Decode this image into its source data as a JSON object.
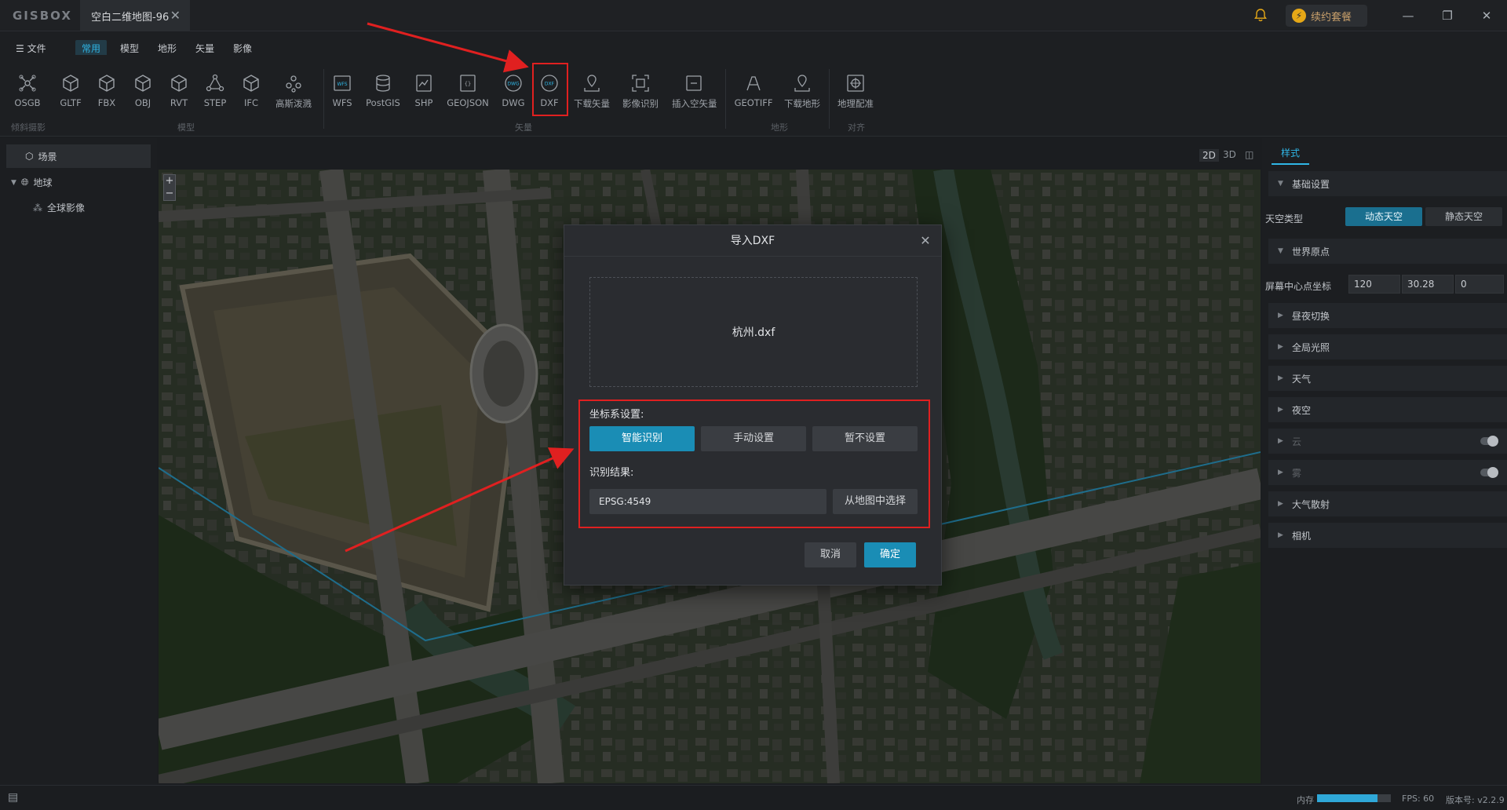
{
  "titlebar": {
    "logo": "GISBOX",
    "doc_tab": "空白二维地图-96",
    "close_glyph": "✕",
    "renew_label": "续约套餐",
    "min_glyph": "—",
    "restore_glyph": "❐",
    "close_window_glyph": "✕"
  },
  "menubar": {
    "file": "文件",
    "tabs": [
      "常用",
      "模型",
      "地形",
      "矢量",
      "影像"
    ],
    "active_tab": "常用"
  },
  "ribbon": {
    "groups": {
      "oblique": "倾斜摄影",
      "model": "模型",
      "vector": "矢量",
      "terrain": "地形",
      "align": "对齐"
    },
    "tools": [
      {
        "label": "OSGB",
        "icon": "osgb-icon"
      },
      {
        "label": "GLTF",
        "icon": "cube-icon"
      },
      {
        "label": "FBX",
        "icon": "cube-icon"
      },
      {
        "label": "OBJ",
        "icon": "cube-icon"
      },
      {
        "label": "RVT",
        "icon": "cube-icon"
      },
      {
        "label": "STEP",
        "icon": "cube-icon"
      },
      {
        "label": "IFC",
        "icon": "cube-icon"
      },
      {
        "label": "高斯泼溅",
        "icon": "splat-icon"
      },
      {
        "label": "WFS",
        "icon": "wfs-icon"
      },
      {
        "label": "PostGIS",
        "icon": "database-icon"
      },
      {
        "label": "SHP",
        "icon": "shp-icon"
      },
      {
        "label": "GEOJSON",
        "icon": "geojson-icon"
      },
      {
        "label": "DWG",
        "icon": "dwg-icon"
      },
      {
        "label": "DXF",
        "icon": "dxf-icon"
      },
      {
        "label": "下载矢量",
        "icon": "download-vector-icon"
      },
      {
        "label": "影像识别",
        "icon": "image-recognition-icon"
      },
      {
        "label": "插入空矢量",
        "icon": "insert-vector-icon"
      },
      {
        "label": "GEOTIFF",
        "icon": "geotiff-icon"
      },
      {
        "label": "下载地形",
        "icon": "download-terrain-icon"
      },
      {
        "label": "地理配准",
        "icon": "georeference-icon"
      }
    ]
  },
  "left_panel": {
    "scene_tab": "场景",
    "tree": [
      {
        "label": "地球",
        "expanded": true
      },
      {
        "label": "全球影像"
      }
    ]
  },
  "view_modes": [
    "2D",
    "3D",
    "◫"
  ],
  "map": {
    "zoom_in": "+",
    "zoom_out": "−"
  },
  "dialog": {
    "title": "导入DXF",
    "close_glyph": "✕",
    "file_name": "杭州.dxf",
    "coord_label": "坐标系设置:",
    "options": [
      "智能识别",
      "手动设置",
      "暂不设置"
    ],
    "selected_option": "智能识别",
    "result_label": "识别结果:",
    "result_value": "EPSG:4549",
    "pick_from_map": "从地图中选择",
    "cancel": "取消",
    "confirm": "确定"
  },
  "right_panel": {
    "tab": "样式",
    "basic_settings": "基础设置",
    "sky_type_label": "天空类型",
    "sky_options": [
      "动态天空",
      "静态天空"
    ],
    "sky_selected": "动态天空",
    "world_origin": "世界原点",
    "screen_center_label": "屏幕中心点坐标",
    "center_values": [
      "120",
      "30.28",
      "0"
    ],
    "sections": [
      {
        "label": "昼夜切换",
        "enabled": true,
        "toggle": false
      },
      {
        "label": "全局光照",
        "enabled": true,
        "toggle": false
      },
      {
        "label": "天气",
        "enabled": true,
        "toggle": false
      },
      {
        "label": "夜空",
        "enabled": true,
        "toggle": false
      },
      {
        "label": "云",
        "enabled": false,
        "toggle": true
      },
      {
        "label": "雾",
        "enabled": false,
        "toggle": true
      },
      {
        "label": "大气散射",
        "enabled": true,
        "toggle": false
      },
      {
        "label": "相机",
        "enabled": true,
        "toggle": false
      }
    ]
  },
  "statusbar": {
    "memory_label": "内存",
    "memory_fraction": 0.82,
    "fps": "FPS: 60",
    "version": "版本号: v2.2.9"
  },
  "colors": {
    "accent": "#1a8db5",
    "highlight": "#e02020",
    "panel": "#1c1e21"
  }
}
